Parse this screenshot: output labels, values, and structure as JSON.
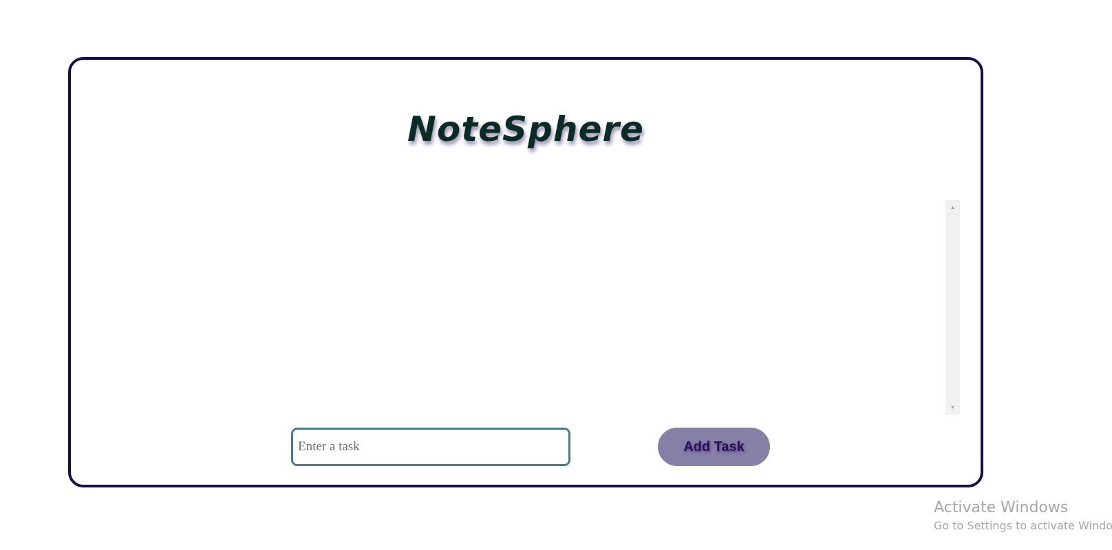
{
  "app": {
    "title": "NoteSphere"
  },
  "task_list": {
    "items": [],
    "scroll_up_icon": "triangle-up",
    "scroll_down_icon": "triangle-down"
  },
  "task_form": {
    "input_value": "",
    "input_placeholder": "Enter a task",
    "add_button_label": "Add Task"
  },
  "watermark": {
    "title": "Activate Windows",
    "subtitle": "Go to Settings to activate Windows."
  },
  "colors": {
    "card_border": "#15104a",
    "title_text": "#0b2b27",
    "input_border": "#4a7890",
    "button_background": "#8680a6",
    "button_text": "#2b0d5e"
  }
}
